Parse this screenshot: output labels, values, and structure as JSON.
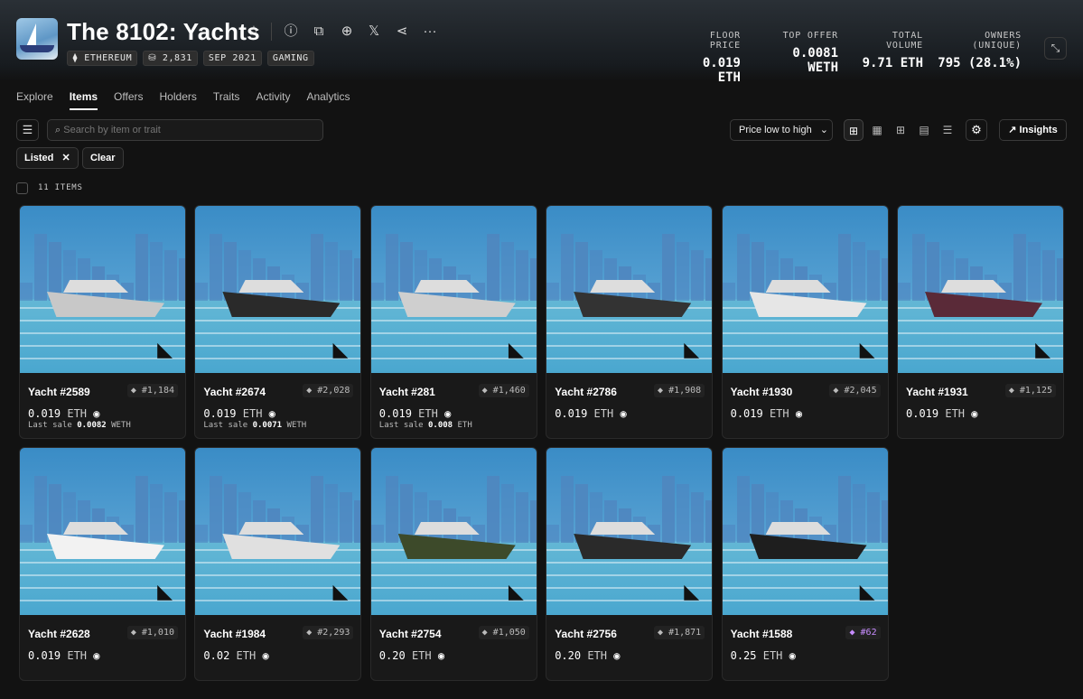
{
  "collection": {
    "title": "The 8102: Yachts",
    "badges": [
      "⧫ ETHEREUM",
      "⛁ 2,831",
      "SEP 2021",
      "GAMING"
    ]
  },
  "stats": [
    {
      "label": "FLOOR PRICE",
      "value": "0.019 ETH"
    },
    {
      "label": "TOP OFFER",
      "value": "0.0081 WETH"
    },
    {
      "label": "TOTAL VOLUME",
      "value": "9.71 ETH"
    },
    {
      "label": "OWNERS (UNIQUE)",
      "value": "795 (28.1%)"
    }
  ],
  "tabs": [
    "Explore",
    "Items",
    "Offers",
    "Holders",
    "Traits",
    "Activity",
    "Analytics"
  ],
  "search": {
    "placeholder": "Search by item or trait"
  },
  "sort": {
    "label": "Price low to high"
  },
  "insights_label": "Insights",
  "filters": {
    "listed": "Listed",
    "clear": "Clear"
  },
  "items_count": "11 ITEMS",
  "items": [
    {
      "name": "Yacht #2589",
      "rank": "#1,184",
      "price": "0.019",
      "unit": "ETH",
      "last_sale_label": "Last sale",
      "last_sale_value": "0.0082",
      "last_sale_unit": "WETH",
      "hull": "#c8c8c8"
    },
    {
      "name": "Yacht #2674",
      "rank": "#2,028",
      "price": "0.019",
      "unit": "ETH",
      "last_sale_label": "Last sale",
      "last_sale_value": "0.0071",
      "last_sale_unit": "WETH",
      "hull": "#2a2a2a"
    },
    {
      "name": "Yacht #281",
      "rank": "#1,460",
      "price": "0.019",
      "unit": "ETH",
      "last_sale_label": "Last sale",
      "last_sale_value": "0.008",
      "last_sale_unit": "ETH",
      "hull": "#cfcfcf"
    },
    {
      "name": "Yacht #2786",
      "rank": "#1,908",
      "price": "0.019",
      "unit": "ETH",
      "hull": "#333333"
    },
    {
      "name": "Yacht #1930",
      "rank": "#2,045",
      "price": "0.019",
      "unit": "ETH",
      "hull": "#e6e6e6"
    },
    {
      "name": "Yacht #1931",
      "rank": "#1,125",
      "price": "0.019",
      "unit": "ETH",
      "hull": "#5a2a38"
    },
    {
      "name": "Yacht #2628",
      "rank": "#1,010",
      "price": "0.019",
      "unit": "ETH",
      "hull": "#f2f2f2"
    },
    {
      "name": "Yacht #1984",
      "rank": "#2,293",
      "price": "0.02",
      "unit": "ETH",
      "hull": "#e0e0e0"
    },
    {
      "name": "Yacht #2754",
      "rank": "#1,050",
      "price": "0.20",
      "unit": "ETH",
      "hull": "#3d4a2a"
    },
    {
      "name": "Yacht #2756",
      "rank": "#1,871",
      "price": "0.20",
      "unit": "ETH",
      "hull": "#2a2a2a"
    },
    {
      "name": "Yacht #1588",
      "rank": "#62",
      "price": "0.25",
      "unit": "ETH",
      "hull": "#1e1e1e",
      "rank_color": "purple"
    }
  ]
}
